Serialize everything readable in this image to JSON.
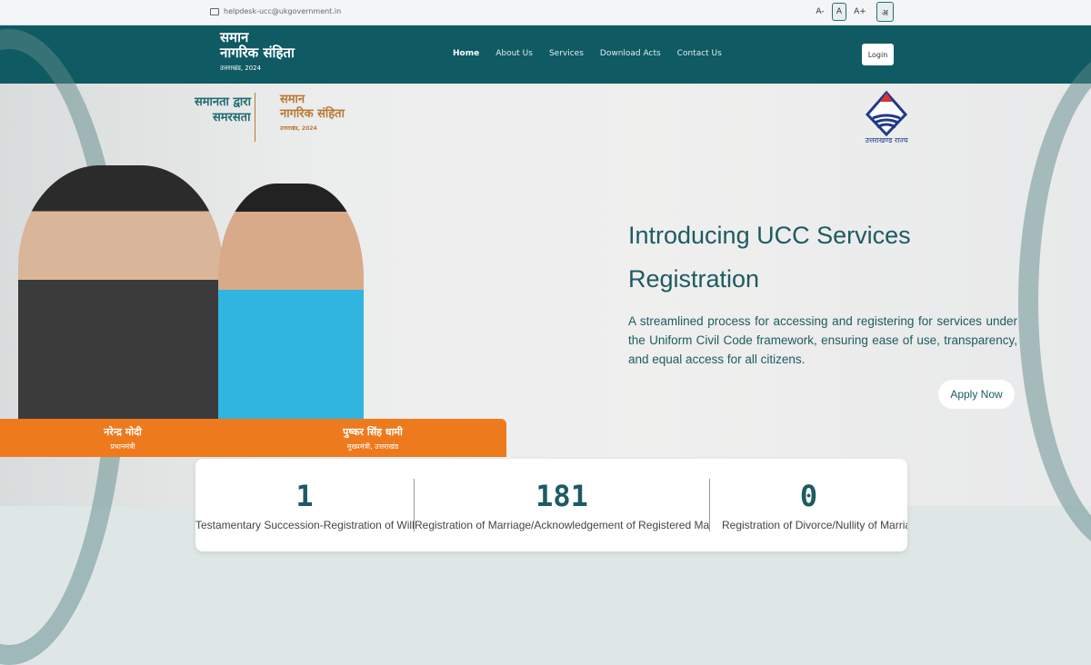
{
  "topbar": {
    "email": "helpdesk-ucc@ukgovernment.in",
    "font_small": "A-",
    "font_normal": "A",
    "font_large": "A+",
    "language": "अ"
  },
  "nav": {
    "logo_line1": "समान",
    "logo_line2": "नागरिक संहिता",
    "logo_line3": "उत्तराखंड, 2024",
    "items": [
      "Home",
      "About Us",
      "Services",
      "Download Acts",
      "Contact Us"
    ],
    "login": "Login"
  },
  "hero": {
    "tagline1": "समानता द्वारा",
    "tagline2": "समरसता",
    "brand1": "समान",
    "brand2": "नागरिक संहिता",
    "brand3": "उत्तराखंड, 2024",
    "state_label": "उत्तराखण्ड राज्य",
    "person1_name": "नरेन्द्र मोदी",
    "person1_title": "प्रधानमंत्री",
    "person2_name": "पुष्कर सिंह धामी",
    "person2_title": "मुख्यमंत्री, उत्तराखंड",
    "title_line1": "Introducing UCC Services",
    "title_line2": "Registration",
    "description": "A streamlined process for accessing and registering for services under the Uniform Civil Code framework, ensuring ease of use, transparency, and equal access for all citizens.",
    "apply": "Apply Now"
  },
  "stats": [
    {
      "value": "1",
      "label": "Testamentary Succession-Registration of Will"
    },
    {
      "value": "181",
      "label": "Registration of Marriage/Acknowledgement of Registered Marriage"
    },
    {
      "value": "0",
      "label": "Registration of Divorce/Nullity of Marriage"
    }
  ],
  "colors": {
    "primary": "#0f5a63",
    "accent": "#ee7a1e"
  }
}
